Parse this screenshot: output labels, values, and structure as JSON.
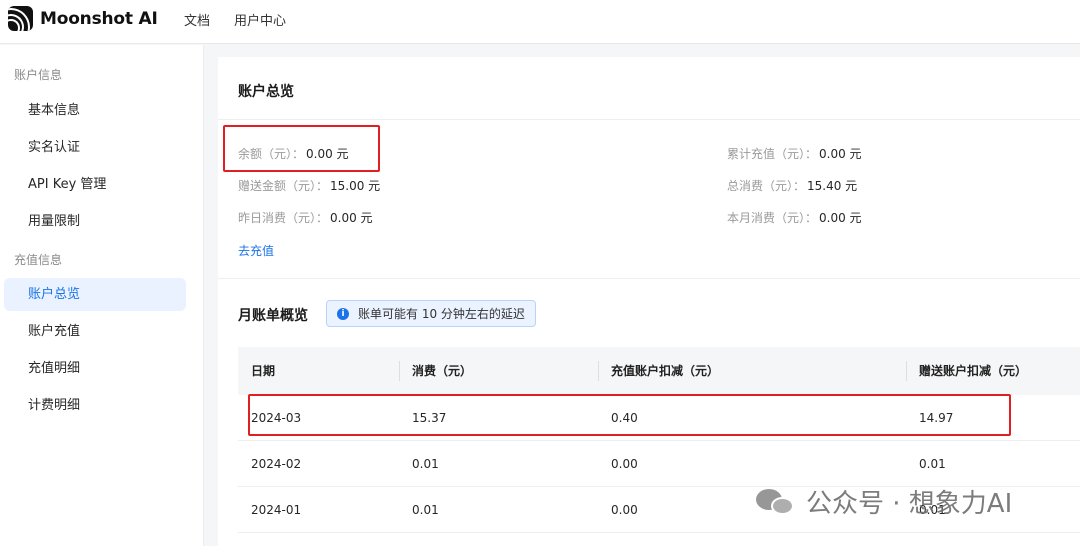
{
  "brand": {
    "name": "Moonshot AI",
    "icon": "moonshot-logo-icon"
  },
  "topnav": [
    "文档",
    "用户中心"
  ],
  "sidebar": {
    "groups": [
      {
        "label": "账户信息",
        "items": [
          "基本信息",
          "实名认证",
          "API Key 管理",
          "用量限制"
        ]
      },
      {
        "label": "充值信息",
        "items": [
          "账户总览",
          "账户充值",
          "充值明细",
          "计费明细"
        ]
      }
    ],
    "active": "账户总览"
  },
  "overview": {
    "title": "账户总览",
    "balance": {
      "label": "余额（元）：",
      "value": "0.00 元"
    },
    "gift_amount": {
      "label": "赠送金额（元）：",
      "value": "15.00 元"
    },
    "yesterday": {
      "label": "昨日消费（元）：",
      "value": "0.00 元"
    },
    "total_recharge": {
      "label": "累计充值（元）：",
      "value": "0.00 元"
    },
    "total_spend": {
      "label": "总消费（元）：",
      "value": "15.40 元"
    },
    "month_spend": {
      "label": "本月消费（元）：",
      "value": "0.00 元"
    },
    "recharge_link": "去充值"
  },
  "monthly": {
    "title": "月账单概览",
    "notice": "账单可能有 10 分钟左右的延迟",
    "columns": [
      "日期",
      "消费（元）",
      "充值账户扣减（元）",
      "赠送账户扣减（元）"
    ],
    "rows": [
      [
        "2024-03",
        "15.37",
        "0.40",
        "14.97"
      ],
      [
        "2024-02",
        "0.01",
        "0.00",
        "0.01"
      ],
      [
        "2024-01",
        "0.01",
        "0.00",
        "0.01"
      ]
    ]
  },
  "watermark": {
    "text": "公众号 · 想象力AI",
    "icon": "wechat-icon"
  },
  "colors": {
    "accent": "#1a73e8",
    "highlight_box": "#e02020",
    "active_bg": "#e9f2fe"
  }
}
